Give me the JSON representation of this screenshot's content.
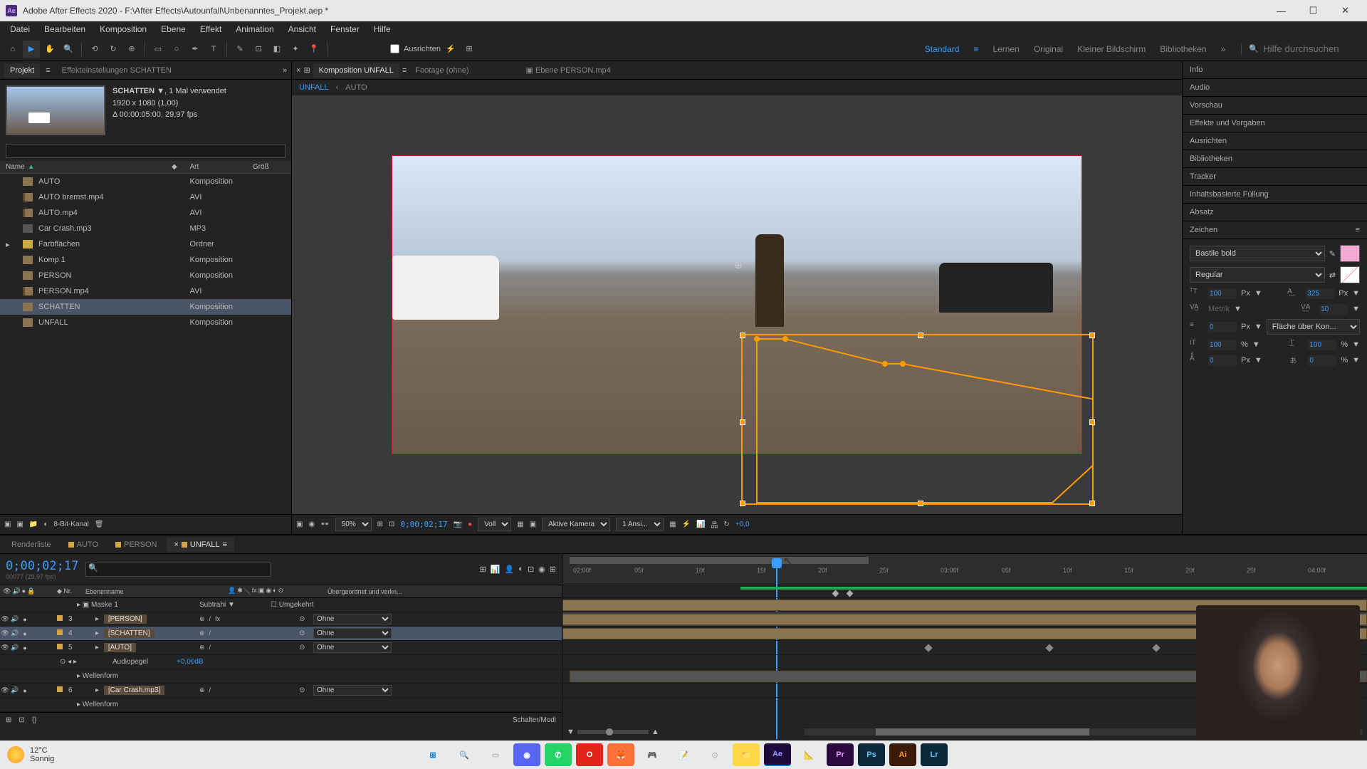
{
  "titlebar": {
    "app_icon": "Ae",
    "title": "Adobe After Effects 2020 - F:\\After Effects\\Autounfall\\Unbenanntes_Projekt.aep *"
  },
  "menu": [
    "Datei",
    "Bearbeiten",
    "Komposition",
    "Ebene",
    "Effekt",
    "Animation",
    "Ansicht",
    "Fenster",
    "Hilfe"
  ],
  "toolbar": {
    "align_label": "Ausrichten",
    "workspaces": [
      "Standard",
      "Lernen",
      "Original",
      "Kleiner Bildschirm",
      "Bibliotheken"
    ],
    "active_workspace": "Standard",
    "search_placeholder": "Hilfe durchsuchen"
  },
  "project_panel": {
    "tab_project": "Projekt",
    "tab_effects": "Effekteinstellungen SCHATTEN",
    "selected_name": "SCHATTEN",
    "selected_usage": ", 1 Mal verwendet",
    "selected_res": "1920 x 1080 (1,00)",
    "selected_dur": "Δ 00:00:05:00, 29,97 fps",
    "headers": {
      "name": "Name",
      "type": "Art",
      "size": "Größ"
    },
    "items": [
      {
        "name": "AUTO",
        "type": "Komposition",
        "icon": "comp"
      },
      {
        "name": "AUTO bremst.mp4",
        "type": "AVI",
        "icon": "video"
      },
      {
        "name": "AUTO.mp4",
        "type": "AVI",
        "icon": "video"
      },
      {
        "name": "Car Crash.mp3",
        "type": "MP3",
        "icon": "audio"
      },
      {
        "name": "Farbflächen",
        "type": "Ordner",
        "icon": "folder"
      },
      {
        "name": "Komp 1",
        "type": "Komposition",
        "icon": "comp"
      },
      {
        "name": "PERSON",
        "type": "Komposition",
        "icon": "comp"
      },
      {
        "name": "PERSON.mp4",
        "type": "AVI",
        "icon": "video"
      },
      {
        "name": "SCHATTEN",
        "type": "Komposition",
        "icon": "comp",
        "selected": true
      },
      {
        "name": "UNFALL",
        "type": "Komposition",
        "icon": "comp"
      }
    ],
    "footer_depth": "8-Bit-Kanal"
  },
  "comp_panel": {
    "tab_comp_prefix": "Komposition",
    "tab_comp_name": "UNFALL",
    "tab_footage": "Footage  (ohne)",
    "tab_layer_prefix": "Ebene",
    "tab_layer_name": "PERSON.mp4",
    "breadcrumb": [
      "UNFALL",
      "AUTO"
    ]
  },
  "viewer_footer": {
    "zoom": "50%",
    "timecode": "0;00;02;17",
    "resolution": "Voll",
    "camera": "Aktive Kamera",
    "views": "1 Ansi...",
    "exposure": "+0,0"
  },
  "right_panels": [
    "Info",
    "Audio",
    "Vorschau",
    "Effekte und Vorgaben",
    "Ausrichten",
    "Bibliotheken",
    "Tracker",
    "Inhaltsbasierte Füllung",
    "Absatz"
  ],
  "char_panel": {
    "title": "Zeichen",
    "font": "Bastile bold",
    "style": "Regular",
    "size_val": "100",
    "size_unit": "Px",
    "leading_val": "325",
    "leading_unit": "Px",
    "kerning": "Metrik",
    "tracking": "10",
    "stroke": "0",
    "stroke_unit": "Px",
    "stroke_mode": "Fläche über Kon...",
    "vscale": "100",
    "vscale_unit": "%",
    "hscale": "100",
    "hscale_unit": "%",
    "baseline": "0",
    "baseline_unit": "Px",
    "tsume": "0",
    "tsume_unit": "%",
    "color": "#f4a8d4"
  },
  "timeline": {
    "tab_render": "Renderliste",
    "tabs": [
      "AUTO",
      "PERSON",
      "UNFALL"
    ],
    "active_tab": "UNFALL",
    "timecode": "0;00;02;17",
    "frame_info": "00077 (29,97 fps)",
    "col_nr": "Nr.",
    "col_name": "Ebenenname",
    "col_parent": "Übergeordnet und verkn...",
    "mode_subtract": "Subtrahi",
    "mode_invert": "Umgekehrt",
    "none": "Ohne",
    "layers": [
      {
        "nr": "",
        "name": "Maske 1",
        "indent": 2,
        "type": "mask"
      },
      {
        "nr": "3",
        "name": "[PERSON]",
        "indent": 1,
        "type": "layer"
      },
      {
        "nr": "4",
        "name": "[SCHATTEN]",
        "indent": 1,
        "type": "layer",
        "selected": true
      },
      {
        "nr": "5",
        "name": "[AUTO]",
        "indent": 1,
        "type": "layer"
      },
      {
        "nr": "",
        "name": "Audiopegel",
        "indent": 2,
        "type": "param",
        "value": "+0,00dB"
      },
      {
        "nr": "",
        "name": "Wellenform",
        "indent": 2,
        "type": "param"
      },
      {
        "nr": "6",
        "name": "[Car Crash.mp3]",
        "indent": 1,
        "type": "layer"
      },
      {
        "nr": "",
        "name": "Wellenform",
        "indent": 2,
        "type": "param"
      }
    ],
    "ruler_ticks": [
      "02:00f",
      "05f",
      "10f",
      "15f",
      "20f",
      "25f",
      "03:00f",
      "05f",
      "10f",
      "15f",
      "20f",
      "25f",
      "04:00f"
    ],
    "footer_mode": "Schalter/Modi"
  },
  "taskbar": {
    "temp": "12°C",
    "cond": "Sonnig"
  }
}
